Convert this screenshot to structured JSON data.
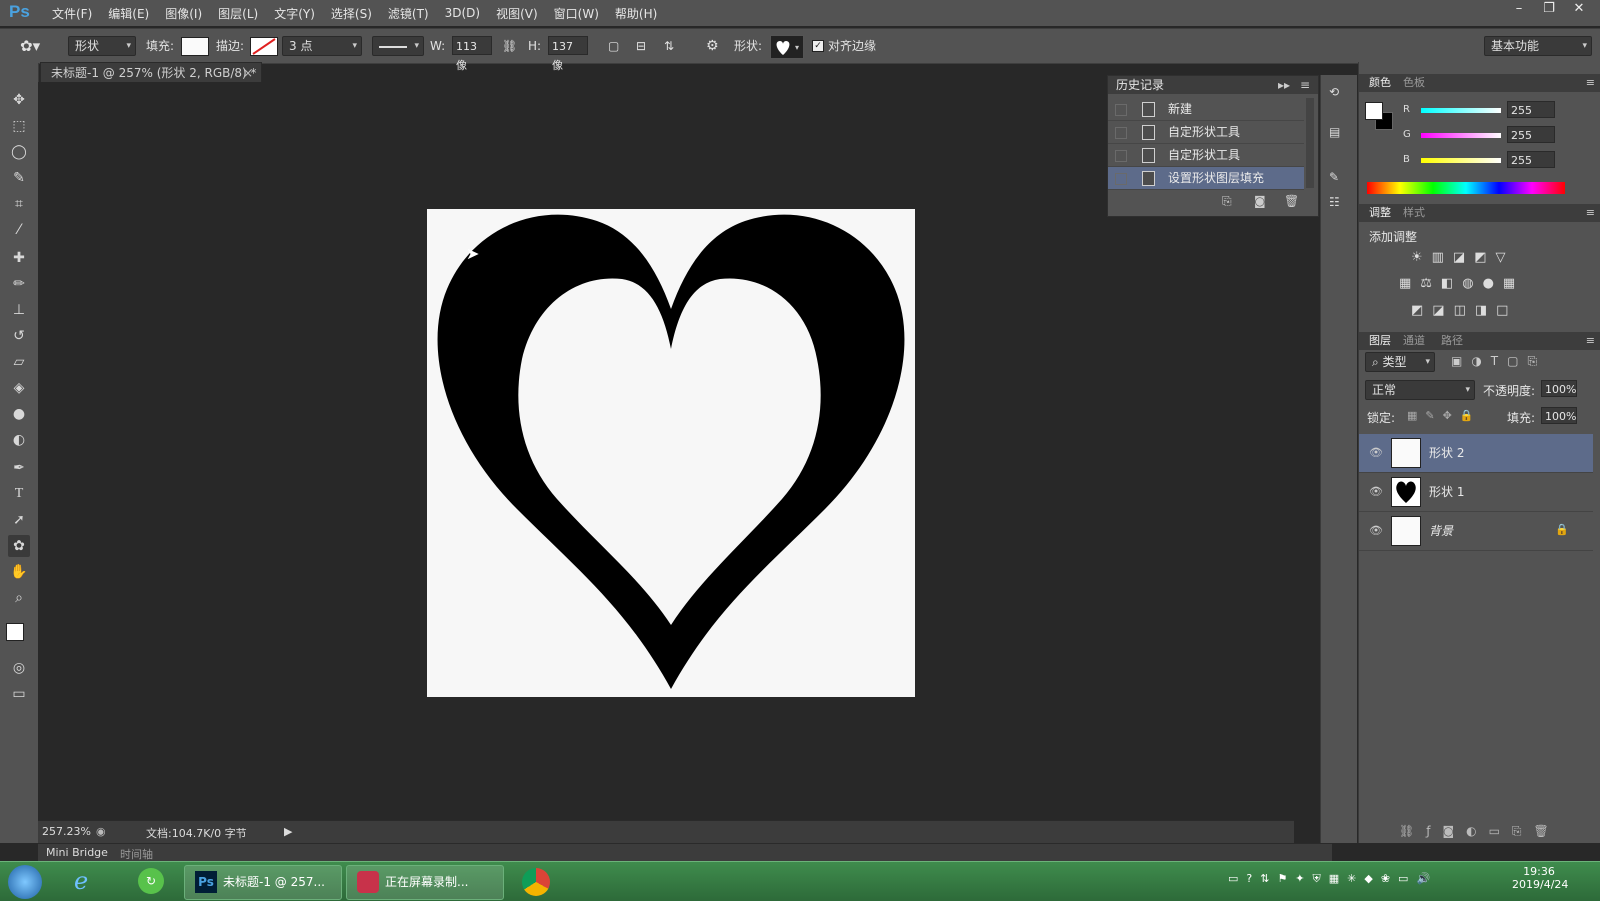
{
  "app": {
    "logo": "Ps"
  },
  "menu": [
    "文件(F)",
    "编辑(E)",
    "图像(I)",
    "图层(L)",
    "文字(Y)",
    "选择(S)",
    "滤镜(T)",
    "3D(D)",
    "视图(V)",
    "窗口(W)",
    "帮助(H)"
  ],
  "window_controls": {
    "minimize": "–",
    "restore": "❐",
    "close": "✕"
  },
  "options": {
    "mode": "形状",
    "fill_label": "填充:",
    "stroke_label": "描边:",
    "stroke_width": "3 点",
    "w_label": "W:",
    "w_value": "113 像",
    "h_label": "H:",
    "h_value": "137 像",
    "shape_label": "形状:",
    "align_edges": "对齐边缘",
    "workspace": "基本功能"
  },
  "document": {
    "tab_title": "未标题-1 @ 257% (形状 2, RGB/8) *",
    "zoom": "257.23%",
    "doc_info": "文档:104.7K/0 字节"
  },
  "bottom_tabs": {
    "mini_bridge": "Mini Bridge",
    "timeline": "时间轴"
  },
  "history": {
    "title": "历史记录",
    "items": [
      "新建",
      "自定形状工具",
      "自定形状工具",
      "设置形状图层填充"
    ],
    "selected_index": 3
  },
  "color_panel": {
    "tabs": [
      "颜色",
      "色板"
    ],
    "channels": [
      {
        "name": "R",
        "value": "255"
      },
      {
        "name": "G",
        "value": "255"
      },
      {
        "name": "B",
        "value": "255"
      }
    ]
  },
  "adjust_panel": {
    "tabs": [
      "调整",
      "样式"
    ],
    "heading": "添加调整"
  },
  "layers_panel": {
    "tabs": [
      "图层",
      "通道",
      "路径"
    ],
    "filter": "类型",
    "blend_mode": "正常",
    "opacity_label": "不透明度:",
    "opacity": "100%",
    "lock_label": "锁定:",
    "fill_label": "填充:",
    "fill": "100%",
    "layers": [
      {
        "name": "形状 2",
        "selected": true
      },
      {
        "name": "形状 1",
        "selected": false
      },
      {
        "name": "背景",
        "selected": false
      }
    ]
  },
  "taskbar": {
    "apps": [
      {
        "name": "未标题-1 @ 257..."
      },
      {
        "name": "正在屏幕录制..."
      }
    ],
    "time": "19:36",
    "date": "2019/4/24"
  },
  "colors": {
    "accent": "#4aa2e0",
    "selected_row": "#5d6b8a",
    "taskbar": "#2d6a39"
  }
}
